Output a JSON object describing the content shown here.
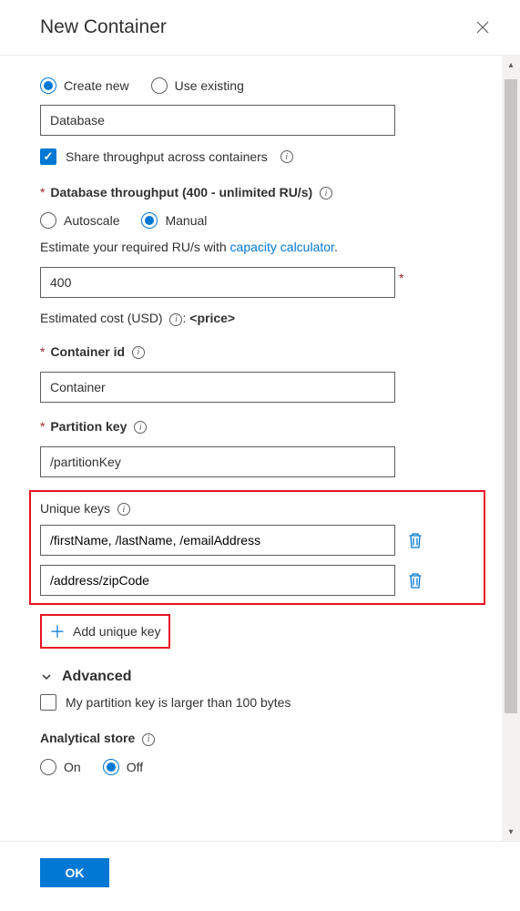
{
  "header": {
    "title": "New Container"
  },
  "dbMode": {
    "createNew": "Create new",
    "useExisting": "Use existing",
    "selected": "createNew"
  },
  "databaseName": "Database",
  "shareThroughput": {
    "label": "Share throughput across containers",
    "checked": true
  },
  "throughput": {
    "label": "Database throughput (400 - unlimited RU/s)",
    "autoscale": "Autoscale",
    "manual": "Manual",
    "selected": "manual",
    "estimateText": "Estimate your required RU/s with ",
    "linkText": "capacity calculator",
    "periodAfterLink": ".",
    "value": "400",
    "costLabel": "Estimated cost (USD) ",
    "costValue": "<price>"
  },
  "containerId": {
    "label": "Container id",
    "value": "Container"
  },
  "partitionKey": {
    "label": "Partition key",
    "value": "/partitionKey"
  },
  "uniqueKeys": {
    "label": "Unique keys",
    "items": [
      "/firstName, /lastName, /emailAddress",
      "/address/zipCode"
    ],
    "addLabel": "Add unique key"
  },
  "advanced": {
    "label": "Advanced",
    "largeKey": "My partition key is larger than 100 bytes",
    "largeKeyChecked": false
  },
  "analytical": {
    "label": "Analytical store",
    "on": "On",
    "off": "Off",
    "selected": "off"
  },
  "footer": {
    "ok": "OK"
  }
}
